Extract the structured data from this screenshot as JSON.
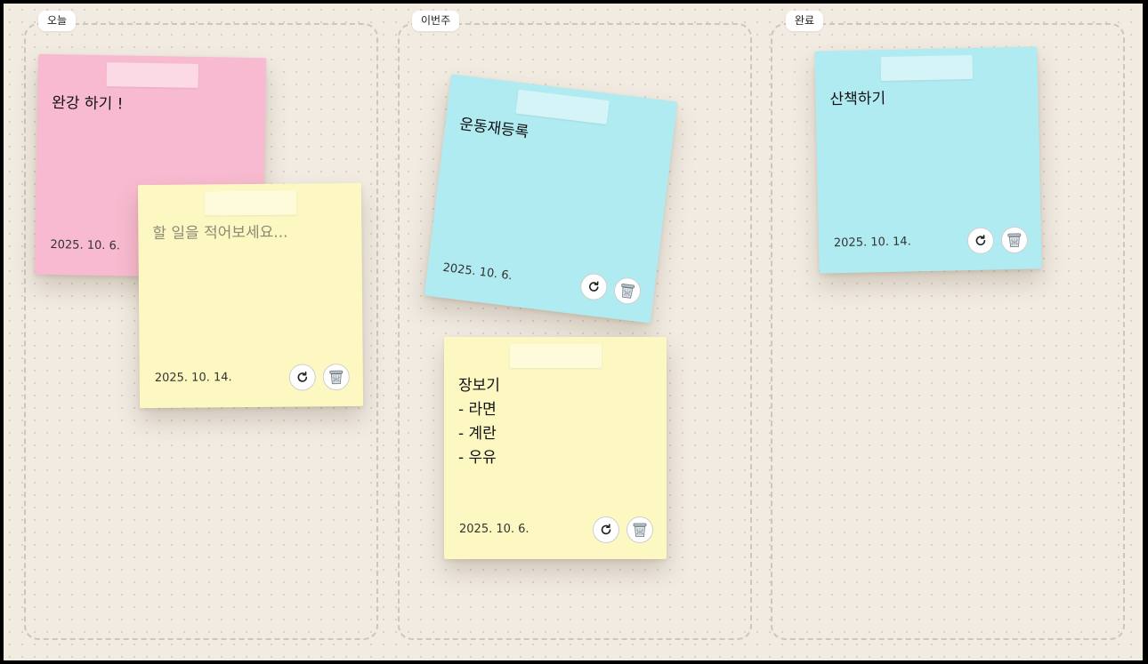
{
  "columns": [
    {
      "id": "today",
      "label": "오늘"
    },
    {
      "id": "week",
      "label": "이번주"
    },
    {
      "id": "done",
      "label": "완료"
    }
  ],
  "notes": [
    {
      "column": "오늘",
      "color": "#f8bad0",
      "text": "완강 하기 !",
      "date": "2025. 10. 6."
    },
    {
      "column": "오늘",
      "color": "#fdf8c2",
      "text": "",
      "placeholder": "할 일을 적어보세요...",
      "date": "2025. 10. 14."
    },
    {
      "column": "이번주",
      "color": "#b1ebf2",
      "text": "운동재등록",
      "date": "2025. 10. 6."
    },
    {
      "column": "이번주",
      "color": "#fdf8c2",
      "text": "장보기\n- 라면\n- 계란\n- 우유",
      "date": "2025. 10. 6."
    },
    {
      "column": "완료",
      "color": "#b1ebf2",
      "text": "산책하기",
      "date": "2025. 10. 14."
    }
  ],
  "icons": {
    "rotate": "rotate-icon",
    "trash": "trash-icon"
  }
}
